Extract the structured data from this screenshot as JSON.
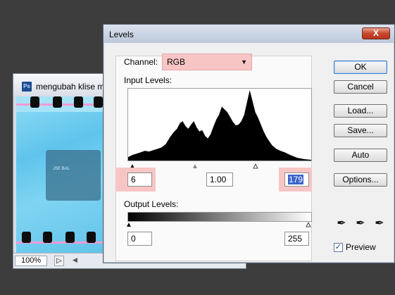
{
  "document_window": {
    "title": "mengubah klise m",
    "ps_icon": "Ps",
    "zoom": "100%",
    "object_label": "JSE BAL"
  },
  "dialog": {
    "title": "Levels",
    "close_label": "X",
    "channel": {
      "label": "Channel:",
      "value": "RGB",
      "dropdown_icon": "triangle-down"
    },
    "input_levels": {
      "label": "Input Levels:",
      "black": "6",
      "gamma": "1.00",
      "white": "179"
    },
    "output_levels": {
      "label": "Output Levels:",
      "black": "0",
      "white": "255"
    },
    "buttons": {
      "ok": "OK",
      "cancel": "Cancel",
      "load": "Load...",
      "save": "Save...",
      "auto": "Auto",
      "options": "Options..."
    },
    "eyedroppers": [
      "black-eyedropper-icon",
      "gray-eyedropper-icon",
      "white-eyedropper-icon"
    ],
    "preview": {
      "label": "Preview",
      "checked": true
    },
    "colors": {
      "highlight": "#f8c5c5",
      "selection": "#3a64c8",
      "close_button": "#c8472e"
    }
  }
}
